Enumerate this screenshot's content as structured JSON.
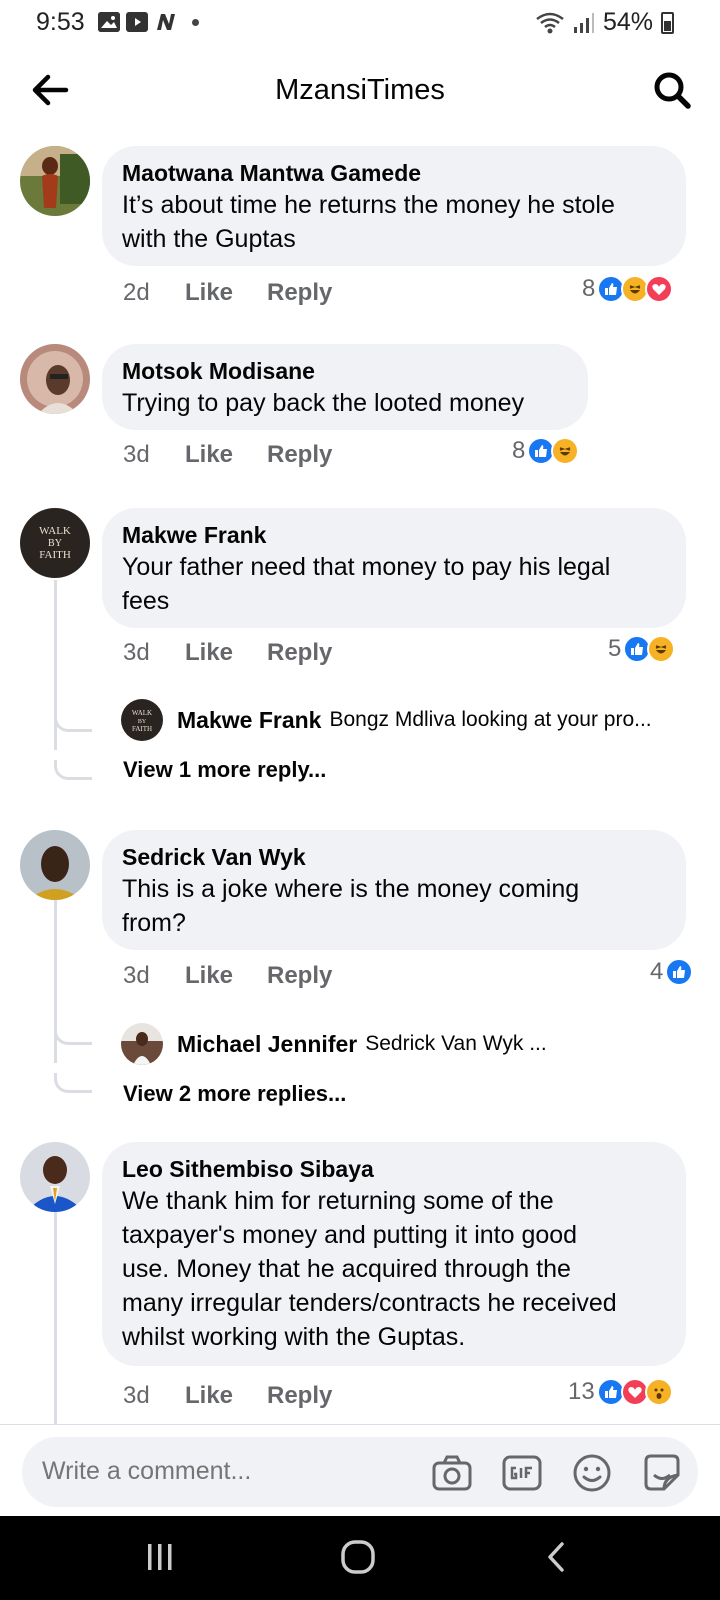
{
  "status_bar": {
    "time": "9:53",
    "battery": "54%",
    "icons": [
      "gallery-icon",
      "youtube-icon",
      "n-app-icon",
      "dot-icon",
      "wifi-icon",
      "signal-icon",
      "battery-icon"
    ]
  },
  "header": {
    "title": "MzansiTimes",
    "back_icon": "arrow-left-icon",
    "search_icon": "search-icon"
  },
  "comments": [
    {
      "author": "Maotwana Mantwa Gamede",
      "text_lines": [
        "It’s about time he returns the money he stole",
        "with the Guptas"
      ],
      "age": "2d",
      "like": "Like",
      "reply": "Reply",
      "reaction_count": "8",
      "reactions": [
        "like",
        "haha",
        "love"
      ]
    },
    {
      "author": "Motsok Modisane",
      "text_lines": [
        "Trying to pay back the looted money"
      ],
      "age": "3d",
      "like": "Like",
      "reply": "Reply",
      "reaction_count": "8",
      "reactions": [
        "like",
        "haha"
      ]
    },
    {
      "author": "Makwe Frank",
      "avatar_text": [
        "WALK",
        "BY",
        "FAITH"
      ],
      "text_lines": [
        "Your father need that money to pay his legal",
        "fees"
      ],
      "age": "3d",
      "like": "Like",
      "reply": "Reply",
      "reaction_count": "5",
      "reactions": [
        "like",
        "haha"
      ],
      "reply_preview": {
        "author": "Makwe Frank",
        "snippet": "Bongz Mdliva looking at your pro..."
      },
      "view_more": "View 1 more reply..."
    },
    {
      "author": "Sedrick Van Wyk",
      "text_lines": [
        "This is a joke where is the money coming",
        "from?"
      ],
      "age": "3d",
      "like": "Like",
      "reply": "Reply",
      "reaction_count": "4",
      "reactions": [
        "like"
      ],
      "reply_preview": {
        "author": "Michael Jennifer",
        "snippet": "Sedrick Van Wyk ..."
      },
      "view_more": "View 2 more replies..."
    },
    {
      "author": "Leo Sithembiso Sibaya",
      "text_lines": [
        "We thank him for returning some of the",
        "taxpayer's money and putting it into good",
        "use. Money that he acquired through the",
        "many irregular tenders/contracts he received",
        "whilst working with the Guptas."
      ],
      "age": "3d",
      "like": "Like",
      "reply": "Reply",
      "reaction_count": "13",
      "reactions": [
        "like",
        "love",
        "wow"
      ]
    }
  ],
  "composer": {
    "placeholder": "Write a comment...",
    "icons": [
      "camera-icon",
      "gif-icon",
      "emoji-icon",
      "sticker-icon"
    ]
  },
  "nav_bar": {
    "icons": [
      "recent-apps-icon",
      "home-icon",
      "back-nav-icon"
    ]
  },
  "colors": {
    "bubble": "#f0f2f5",
    "like_blue": "#1877f2",
    "haha_yellow": "#f7b125",
    "love_red": "#f33e58",
    "meta_gray": "#65676b"
  }
}
